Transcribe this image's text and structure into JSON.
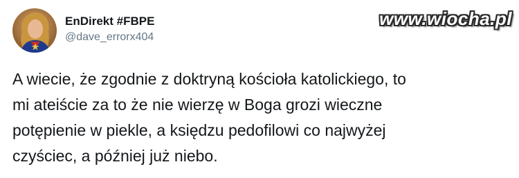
{
  "author": {
    "display_name": "EnDirekt #FBPE",
    "handle": "@dave_errorx404",
    "avatar_icon": "profile-avatar"
  },
  "watermark": "www.wiocha.pl",
  "tweet": {
    "lines": [
      "A wiecie, że zgodnie z doktryną kościoła katolickiego, to",
      "mi ateiście za to że nie wierzę w Boga grozi wieczne",
      "potępienie w piekle, a księdzu pedofilowi co najwyżej",
      "czyściec, a później już niebo."
    ]
  },
  "colors": {
    "text": "#14171a",
    "handle": "#657786",
    "background": "#ffffff"
  }
}
